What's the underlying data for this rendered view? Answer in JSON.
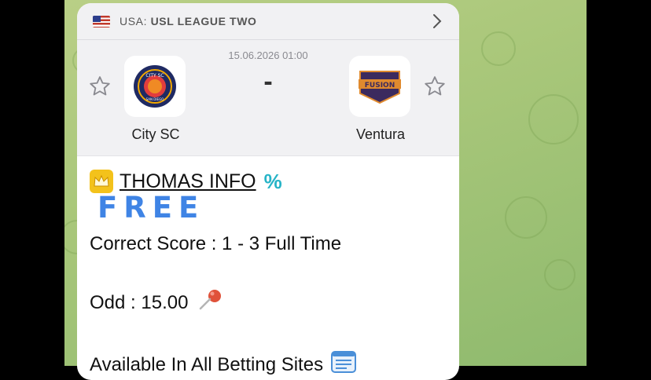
{
  "match": {
    "league_country": "USA:",
    "league_name": "USL LEAGUE TWO",
    "datetime": "15.06.2026 01:00",
    "score": "-",
    "home_team": "City SC",
    "away_team": "Ventura",
    "home_badge_text": "CITY SC",
    "home_badge_subtext": "SAN DIEGO",
    "away_badge_text": "FUSION"
  },
  "message": {
    "title": "THOMAS INFO",
    "tag": "FREE",
    "correct_score": "Correct Score :  1 - 3 Full Time",
    "odd": "Odd :  15.00",
    "available": "Available In All Betting Sites"
  },
  "icons": {
    "flag": "us-flag-icon",
    "chevron": "chevron-right-icon",
    "favorite": "star-outline-icon",
    "crown": "crown-icon",
    "percent": "percent-emoji",
    "pin": "pushpin-emoji",
    "document": "document-emoji"
  },
  "colors": {
    "chat_background": "#a9c77a",
    "card": "#ffffff",
    "header": "#f1f1f3",
    "free_blue": "#3f84e5",
    "percent_teal": "#27b4c7"
  }
}
